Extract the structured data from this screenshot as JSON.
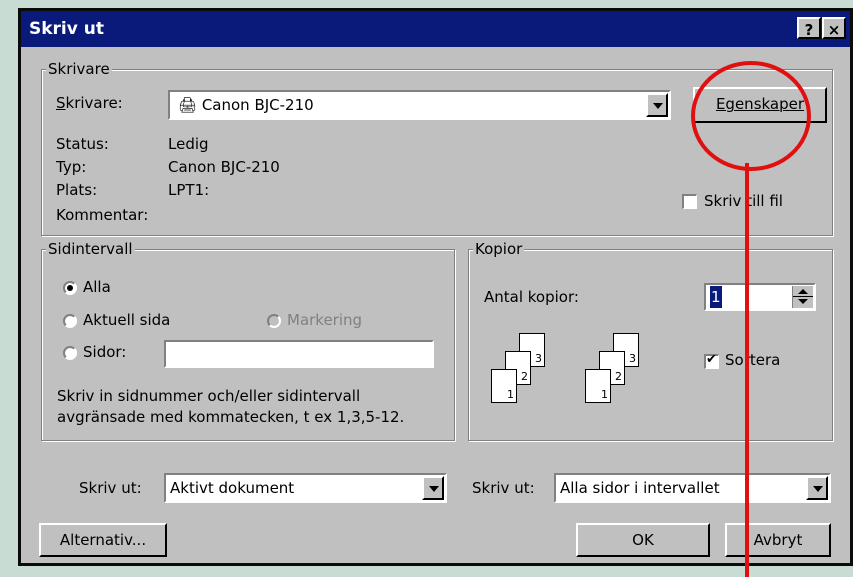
{
  "dialog": {
    "title": "Skriv ut",
    "help_button": "?",
    "close_button": "×"
  },
  "printer_group": {
    "legend": "Skrivare",
    "printer_label": "Skrivare:",
    "printer_value": "Canon  BJC-210",
    "properties_button": "Egenskaper",
    "status_label": "Status:",
    "status_value": "Ledig",
    "type_label": "Typ:",
    "type_value": "Canon  BJC-210",
    "location_label": "Plats:",
    "location_value": "LPT1:",
    "comment_label": "Kommentar:",
    "print_to_file_label": "Skriv till fil",
    "print_to_file_checked": false
  },
  "page_range": {
    "legend": "Sidintervall",
    "all_label": "Alla",
    "current_page_label": "Aktuell sida",
    "selection_label": "Markering",
    "pages_label": "Sidor:",
    "pages_value": "",
    "selected": "all",
    "hint_line1": "Skriv in sidnummer och/eller sidintervall",
    "hint_line2": "avgränsade med kommatecken, t ex 1,3,5-12."
  },
  "copies": {
    "legend": "Kopior",
    "count_label": "Antal kopior:",
    "count_value": "1",
    "collate_label": "Sortera",
    "collate_checked": true,
    "page_numbers": [
      "1",
      "2",
      "3"
    ]
  },
  "bottom": {
    "print_what_label": "Skriv ut:",
    "print_what_value": "Aktivt dokument",
    "print_label": "Skriv ut:",
    "print_value": "Alla sidor i intervallet",
    "options_button": "Alternativ...",
    "ok_button": "OK",
    "cancel_button": "Avbryt"
  },
  "colors": {
    "titlebar": "#0a1a7a",
    "dialog_bg": "#c0c0c0",
    "annotation": "#e01010",
    "backdrop": "#c9dcd4"
  }
}
